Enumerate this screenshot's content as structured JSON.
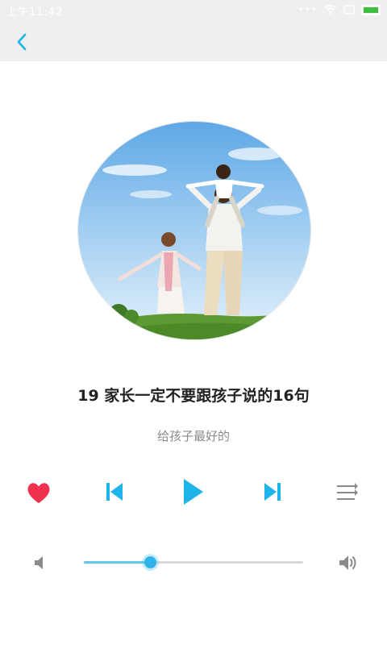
{
  "status_bar": {
    "time": "上午11:42"
  },
  "track": {
    "title": "19 家长一定不要跟孩子说的16句",
    "subtitle": "给孩子最好的"
  },
  "controls": {
    "favorite_active": true,
    "volume_level": 0.3
  },
  "colors": {
    "accent": "#1fb4e9",
    "favorite": "#f0314e",
    "icon_gray": "#8a8a8a",
    "bar_background": "#efefef"
  },
  "icons": {
    "back": "chevron-left-icon",
    "favorite": "heart-icon",
    "previous": "skip-previous-icon",
    "play": "play-icon",
    "next": "skip-next-icon",
    "playlist": "playlist-icon",
    "volume_low": "volume-low-icon",
    "volume_high": "volume-high-icon"
  }
}
